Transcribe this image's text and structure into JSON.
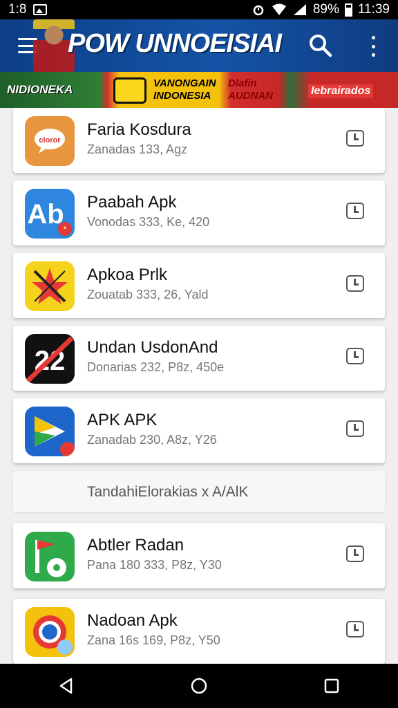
{
  "status_bar": {
    "time_left": "1:8",
    "battery_percent": "89%",
    "clock": "11:39"
  },
  "app_bar": {
    "title": "POW UNNOEISIAI",
    "menu_icon": "hamburger-menu-icon",
    "search_icon": "search-icon",
    "more_icon": "more-vert-icon"
  },
  "banner": {
    "left_text": "NIDIONEKA",
    "mid_line1": "VANONGAIN",
    "mid_line2": "INDONESIA",
    "mid2_line1": "Dlafin",
    "mid2_line2": "AUDNAN",
    "right_text": "Iebrairados"
  },
  "apps": [
    {
      "name": "Faria Kosdura",
      "meta": "Zanadas 133, Agz",
      "icon": "chat-bubble-app-icon",
      "color": "#e8963e"
    },
    {
      "name": "Paabah Apk",
      "meta": "Vonodas 333, Ke, 420",
      "icon": "ab-app-icon",
      "color": "#2f86de"
    },
    {
      "name": "Apkoa Prlk",
      "meta": "Zouatab 333, 26, Yald",
      "icon": "star-app-icon",
      "color": "#f5d21c"
    },
    {
      "name": "Undan UsdonAnd",
      "meta": "Donarias 232, P8z, 450e",
      "icon": "slash-app-icon",
      "color": "#111111"
    },
    {
      "name": "APK APK",
      "meta": "Zanadab 230, A8z, Y26",
      "icon": "play-arrow-app-icon",
      "color": "#1e66c9"
    },
    {
      "name": "Abtler Radan",
      "meta": "Pana 180 333, P8z, Y30",
      "icon": "pin-app-icon",
      "color": "#2eaa4a"
    },
    {
      "name": "Nadoan Apk",
      "meta": "Zana 16s 169, P8z, Y50",
      "icon": "globe-app-icon",
      "color": "#f4c20d"
    }
  ],
  "section": {
    "label": "TandahiElorakias x A/AlK"
  },
  "nav": {
    "back_icon": "back-triangle-icon",
    "home_icon": "home-circle-icon",
    "recents_icon": "recents-square-icon"
  }
}
